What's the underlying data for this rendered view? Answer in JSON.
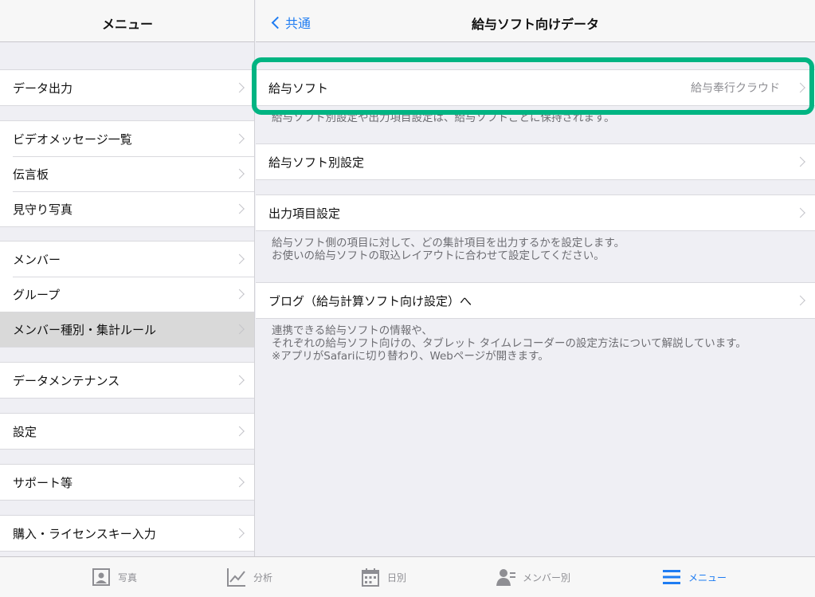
{
  "sidebar": {
    "title": "メニュー",
    "items": [
      {
        "label": "データ出力"
      },
      {
        "label": "ビデオメッセージ一覧"
      },
      {
        "label": "伝言板"
      },
      {
        "label": "見守り写真"
      },
      {
        "label": "メンバー"
      },
      {
        "label": "グループ"
      },
      {
        "label": "メンバー種別・集計ルール",
        "selected": true
      },
      {
        "label": "データメンテナンス"
      },
      {
        "label": "設定"
      },
      {
        "label": "サポート等"
      },
      {
        "label": "購入・ライセンスキー入力"
      }
    ]
  },
  "detail": {
    "back_label": "共通",
    "title": "給与ソフト向けデータ",
    "payroll_soft": {
      "label": "給与ソフト",
      "value": "給与奉行クラウド"
    },
    "payroll_note": "給与ソフト別設定や出力項目設定は、給与ソフトごとに保持されます。",
    "per_soft_settings": "給与ソフト別設定",
    "output_items": "出力項目設定",
    "output_note_1": "給与ソフト側の項目に対して、どの集計項目を出力するかを設定します。",
    "output_note_2": "お使いの給与ソフトの取込レイアウトに合わせて設定してください。",
    "blog": "ブログ（給与計算ソフト向け設定）へ",
    "blog_note_1": "連携できる給与ソフトの情報や、",
    "blog_note_2": "それぞれの給与ソフト向けの、タブレット タイムレコーダーの設定方法について解説しています。",
    "blog_note_3": "※アプリがSafariに切り替わり、Webページが開きます。"
  },
  "highlight_color": "#00b482",
  "accent_color": "#1e7cf2",
  "tabbar": {
    "tabs": [
      {
        "label": "写真",
        "icon": "photo-icon"
      },
      {
        "label": "分析",
        "icon": "chart-icon"
      },
      {
        "label": "日別",
        "icon": "calendar-icon"
      },
      {
        "label": "メンバー別",
        "icon": "member-icon"
      },
      {
        "label": "メニュー",
        "icon": "menu-icon",
        "active": true
      }
    ]
  }
}
